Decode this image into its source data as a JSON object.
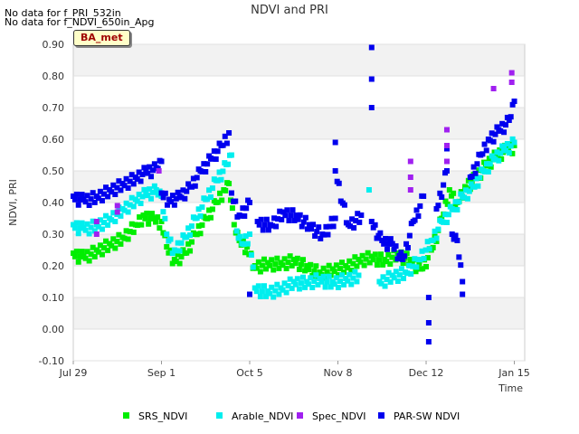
{
  "notes": [
    "No data for f_PRI_532in",
    "No data for f_NDVI_650in_Apg"
  ],
  "site_label": "BA_met",
  "chart_data": {
    "type": "scatter",
    "title": "NDVI and PRI",
    "xlabel": "Time",
    "ylabel": "NDVI, PRI",
    "x_ticks": [
      "Jul 29",
      "Sep 1",
      "Oct 5",
      "Nov 8",
      "Dec 12",
      "Jan 15"
    ],
    "y_ticks": [
      "-0.10",
      "0.00",
      "0.10",
      "0.20",
      "0.30",
      "0.40",
      "0.50",
      "0.60",
      "0.70",
      "0.80",
      "0.90"
    ],
    "xlim": [
      "2023-07-29",
      "2024-01-19"
    ],
    "ylim": [
      -0.1,
      0.9
    ],
    "grid": "horizontal bands",
    "legend_position": "bottom",
    "series": [
      {
        "name": "SRS_NDVI",
        "color": "#00ee00",
        "points": [
          [
            "2023-07-29",
            0.24
          ],
          [
            "2023-08-02",
            0.23
          ],
          [
            "2023-08-07",
            0.25
          ],
          [
            "2023-08-12",
            0.27
          ],
          [
            "2023-08-17",
            0.29
          ],
          [
            "2023-08-22",
            0.33
          ],
          [
            "2023-08-25",
            0.36
          ],
          [
            "2023-08-29",
            0.35
          ],
          [
            "2023-09-01",
            0.34
          ],
          [
            "2023-09-03",
            0.26
          ],
          [
            "2023-09-06",
            0.22
          ],
          [
            "2023-09-10",
            0.24
          ],
          [
            "2023-09-14",
            0.3
          ],
          [
            "2023-09-18",
            0.35
          ],
          [
            "2023-09-22",
            0.4
          ],
          [
            "2023-09-25",
            0.44
          ],
          [
            "2023-09-27",
            0.46
          ],
          [
            "2023-09-29",
            0.33
          ],
          [
            "2023-10-01",
            0.28
          ],
          [
            "2023-10-04",
            0.26
          ],
          [
            "2023-10-07",
            0.2
          ],
          [
            "2023-10-12",
            0.21
          ],
          [
            "2023-10-17",
            0.21
          ],
          [
            "2023-10-22",
            0.22
          ],
          [
            "2023-10-27",
            0.2
          ],
          [
            "2023-11-01",
            0.18
          ],
          [
            "2023-11-06",
            0.19
          ],
          [
            "2023-11-11",
            0.2
          ],
          [
            "2023-11-16",
            0.22
          ],
          [
            "2023-11-21",
            0.23
          ],
          [
            "2023-11-26",
            0.22
          ],
          [
            "2023-12-01",
            0.24
          ],
          [
            "2023-12-06",
            0.22
          ],
          [
            "2023-12-10",
            0.19
          ],
          [
            "2023-12-14",
            0.25
          ],
          [
            "2023-12-18",
            0.35
          ],
          [
            "2023-12-21",
            0.44
          ],
          [
            "2023-12-24",
            0.4
          ],
          [
            "2023-12-27",
            0.45
          ],
          [
            "2023-12-31",
            0.48
          ],
          [
            "2024-01-04",
            0.52
          ],
          [
            "2024-01-08",
            0.55
          ],
          [
            "2024-01-12",
            0.57
          ],
          [
            "2024-01-15",
            0.58
          ]
        ]
      },
      {
        "name": "Arable_NDVI",
        "color": "#00eeee",
        "points": [
          [
            "2023-07-29",
            0.33
          ],
          [
            "2023-08-02",
            0.32
          ],
          [
            "2023-08-07",
            0.33
          ],
          [
            "2023-08-12",
            0.35
          ],
          [
            "2023-08-17",
            0.38
          ],
          [
            "2023-08-22",
            0.41
          ],
          [
            "2023-08-26",
            0.43
          ],
          [
            "2023-08-30",
            0.44
          ],
          [
            "2023-09-01",
            0.42
          ],
          [
            "2023-09-03",
            0.3
          ],
          [
            "2023-09-06",
            0.25
          ],
          [
            "2023-09-10",
            0.29
          ],
          [
            "2023-09-14",
            0.35
          ],
          [
            "2023-09-18",
            0.41
          ],
          [
            "2023-09-22",
            0.47
          ],
          [
            "2023-09-26",
            0.52
          ],
          [
            "2023-09-28",
            0.55
          ],
          [
            "2023-09-30",
            0.31
          ],
          [
            "2023-10-02",
            0.27
          ],
          [
            "2023-10-05",
            0.3
          ],
          [
            "2023-10-07",
            0.13
          ],
          [
            "2023-10-12",
            0.12
          ],
          [
            "2023-10-17",
            0.13
          ],
          [
            "2023-10-22",
            0.15
          ],
          [
            "2023-10-27",
            0.15
          ],
          [
            "2023-11-01",
            0.16
          ],
          [
            "2023-11-06",
            0.15
          ],
          [
            "2023-11-11",
            0.16
          ],
          [
            "2023-11-16",
            0.17
          ],
          [
            "2023-11-20",
            0.44
          ],
          [
            "2023-11-24",
            0.15
          ],
          [
            "2023-11-29",
            0.17
          ],
          [
            "2023-12-04",
            0.18
          ],
          [
            "2023-12-09",
            0.22
          ],
          [
            "2023-12-14",
            0.28
          ],
          [
            "2023-12-18",
            0.34
          ],
          [
            "2023-12-22",
            0.38
          ],
          [
            "2023-12-26",
            0.42
          ],
          [
            "2023-12-30",
            0.45
          ],
          [
            "2024-01-03",
            0.5
          ],
          [
            "2024-01-07",
            0.54
          ],
          [
            "2024-01-11",
            0.57
          ],
          [
            "2024-01-15",
            0.59
          ]
        ]
      },
      {
        "name": "Spec_NDVI",
        "color": "#a020f0",
        "points": [
          [
            "2023-08-07",
            0.3
          ],
          [
            "2023-08-07",
            0.34
          ],
          [
            "2023-08-15",
            0.37
          ],
          [
            "2023-08-15",
            0.39
          ],
          [
            "2023-08-31",
            0.5
          ],
          [
            "2023-12-06",
            0.44
          ],
          [
            "2023-12-06",
            0.48
          ],
          [
            "2023-12-06",
            0.53
          ],
          [
            "2023-12-20",
            0.53
          ],
          [
            "2023-12-20",
            0.58
          ],
          [
            "2023-12-20",
            0.63
          ],
          [
            "2024-01-07",
            0.76
          ],
          [
            "2024-01-14",
            0.78
          ],
          [
            "2024-01-14",
            0.81
          ]
        ]
      },
      {
        "name": "PAR-SW NDVI",
        "color": "#0000ee",
        "points": [
          [
            "2023-07-29",
            0.42
          ],
          [
            "2023-08-02",
            0.41
          ],
          [
            "2023-08-07",
            0.42
          ],
          [
            "2023-08-12",
            0.44
          ],
          [
            "2023-08-17",
            0.46
          ],
          [
            "2023-08-22",
            0.48
          ],
          [
            "2023-08-26",
            0.5
          ],
          [
            "2023-08-30",
            0.51
          ],
          [
            "2023-09-01",
            0.53
          ],
          [
            "2023-09-01",
            0.43
          ],
          [
            "2023-09-04",
            0.41
          ],
          [
            "2023-09-08",
            0.42
          ],
          [
            "2023-09-12",
            0.45
          ],
          [
            "2023-09-16",
            0.5
          ],
          [
            "2023-09-20",
            0.54
          ],
          [
            "2023-09-24",
            0.58
          ],
          [
            "2023-09-27",
            0.62
          ],
          [
            "2023-09-28",
            0.43
          ],
          [
            "2023-10-01",
            0.36
          ],
          [
            "2023-10-05",
            0.4
          ],
          [
            "2023-10-05",
            0.11
          ],
          [
            "2023-10-08",
            0.34
          ],
          [
            "2023-10-13",
            0.33
          ],
          [
            "2023-10-18",
            0.37
          ],
          [
            "2023-10-23",
            0.36
          ],
          [
            "2023-10-28",
            0.33
          ],
          [
            "2023-11-02",
            0.3
          ],
          [
            "2023-11-07",
            0.35
          ],
          [
            "2023-11-07",
            0.59
          ],
          [
            "2023-11-07",
            0.5
          ],
          [
            "2023-11-12",
            0.33
          ],
          [
            "2023-11-17",
            0.36
          ],
          [
            "2023-11-21",
            0.89
          ],
          [
            "2023-11-21",
            0.79
          ],
          [
            "2023-11-21",
            0.7
          ],
          [
            "2023-11-21",
            0.34
          ],
          [
            "2023-11-25",
            0.28
          ],
          [
            "2023-11-29",
            0.27
          ],
          [
            "2023-12-03",
            0.22
          ],
          [
            "2023-12-07",
            0.34
          ],
          [
            "2023-12-11",
            0.42
          ],
          [
            "2023-12-13",
            0.1
          ],
          [
            "2023-12-13",
            0.02
          ],
          [
            "2023-12-13",
            -0.04
          ],
          [
            "2023-12-16",
            0.38
          ],
          [
            "2023-12-20",
            0.5
          ],
          [
            "2023-12-20",
            0.57
          ],
          [
            "2023-12-22",
            0.3
          ],
          [
            "2023-12-24",
            0.28
          ],
          [
            "2023-12-26",
            0.15
          ],
          [
            "2023-12-26",
            0.11
          ],
          [
            "2023-12-29",
            0.48
          ],
          [
            "2024-01-02",
            0.55
          ],
          [
            "2024-01-05",
            0.6
          ],
          [
            "2024-01-09",
            0.63
          ],
          [
            "2024-01-13",
            0.66
          ],
          [
            "2024-01-15",
            0.72
          ]
        ]
      }
    ]
  }
}
